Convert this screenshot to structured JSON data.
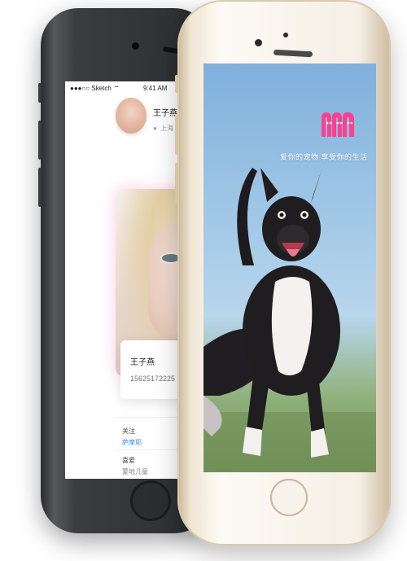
{
  "back_phone": {
    "status_bar": {
      "carrier": "●●●○○ Sketch ⌔",
      "time": "9:41 AM"
    },
    "profile": {
      "name": "王子燕",
      "location": "上海"
    },
    "card": {
      "name": "王子燕",
      "phone": "15625172225"
    },
    "details": [
      {
        "label": "关注",
        "value": "萨摩耶"
      },
      {
        "label": "喜爱",
        "value": "蒙地几童"
      }
    ],
    "accent_color": "#3b8ef0"
  },
  "front_phone": {
    "slogan": "爱你的宠物 享受你的生活",
    "logo_color": "#ff3f8f",
    "icons": [
      "camera-icon",
      "home-button-icon"
    ]
  }
}
